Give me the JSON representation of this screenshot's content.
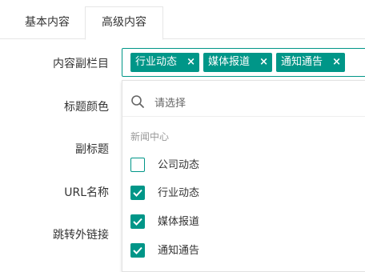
{
  "tabs": [
    {
      "label": "基本内容"
    },
    {
      "label": "高级内容"
    }
  ],
  "form": {
    "labels": [
      "内容副栏目",
      "标题颜色",
      "副标题",
      "URL名称",
      "跳转外链接"
    ]
  },
  "multiselect": {
    "selected": [
      {
        "label": "行业动态"
      },
      {
        "label": "媒体报道"
      },
      {
        "label": "通知通告"
      }
    ],
    "remove_symbol": "×",
    "search_placeholder": "请选择",
    "group_title": "新闻中心",
    "options": [
      {
        "label": "公司动态",
        "checked": false
      },
      {
        "label": "行业动态",
        "checked": true
      },
      {
        "label": "媒体报道",
        "checked": true
      },
      {
        "label": "通知通告",
        "checked": true
      }
    ]
  },
  "colors": {
    "accent": "#009688"
  }
}
